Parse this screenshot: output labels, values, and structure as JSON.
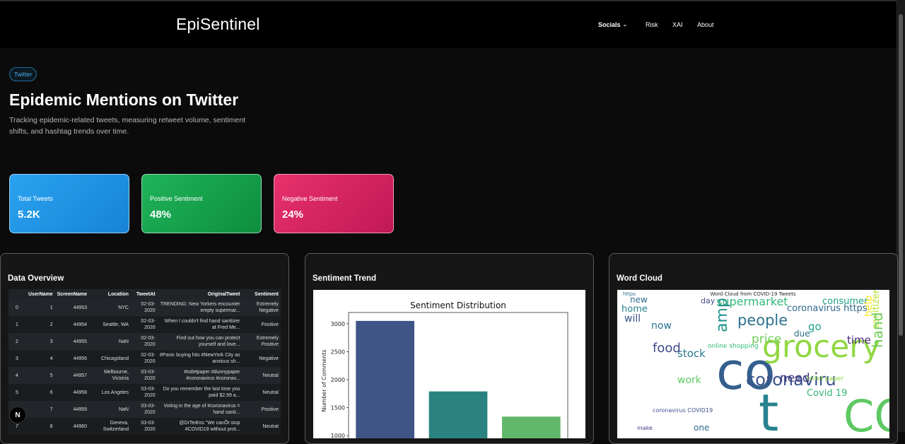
{
  "nav": {
    "brand": "EpiSentinel",
    "items": [
      {
        "label": "Socials",
        "has_dropdown": true
      },
      {
        "label": "Risk"
      },
      {
        "label": "XAI"
      },
      {
        "label": "About"
      }
    ]
  },
  "hero": {
    "badge": "Twitter",
    "title": "Epidemic Mentions on Twitter",
    "subtitle": "Tracking epidemic-related tweets, measuring retweet volume, sentiment shifts, and hashtag trends over time."
  },
  "stats": [
    {
      "label": "Total Tweets",
      "value": "5.2K"
    },
    {
      "label": "Positive Sentiment",
      "value": "48%"
    },
    {
      "label": "Negative Sentiment",
      "value": "24%"
    }
  ],
  "data_overview": {
    "title": "Data Overview",
    "columns": [
      "",
      "UserName",
      "ScreenName",
      "Location",
      "TweetAt",
      "OriginalTweet",
      "Sentiment"
    ],
    "rows": [
      [
        "0",
        "1",
        "44953",
        "NYC",
        "02-03-2020",
        "TRENDING: New Yorkers encounter empty supermar...",
        "Extremely Negative"
      ],
      [
        "1",
        "2",
        "44954",
        "Seattle, WA",
        "02-03-2020",
        "When I couldn't find hand sanitizer at Fred Me...",
        "Positive"
      ],
      [
        "2",
        "3",
        "44955",
        "NaN",
        "02-03-2020",
        "Find out how you can protect yourself and love...",
        "Extremely Positive"
      ],
      [
        "3",
        "4",
        "44956",
        "Chicagoland",
        "02-03-2020",
        "#Panic buying hits #NewYork City as anxious sh...",
        "Negative"
      ],
      [
        "4",
        "5",
        "44957",
        "Melbourne, Victoria",
        "03-03-2020",
        "#toiletpaper #dunnypaper #coronavirus #coronav...",
        "Neutral"
      ],
      [
        "5",
        "6",
        "44958",
        "Los Angeles",
        "03-03-2020",
        "Do you remember the last time you paid $2.99 a...",
        "Neutral"
      ],
      [
        "6",
        "7",
        "44959",
        "NaN",
        "03-03-2020",
        "Voting in the age of #coronavirus = hand sanit...",
        "Positive"
      ],
      [
        "7",
        "8",
        "44960",
        "Geneva, Switzerland",
        "03-03-2020",
        "@DrTedros \"We canÕt stop #COVID19 without prot...",
        "Neutral"
      ]
    ]
  },
  "sentiment_trend": {
    "title": "Sentiment Trend"
  },
  "chart_data": {
    "type": "bar",
    "title": "Sentiment Distribution",
    "ylabel": "Number of Comments",
    "xlabel": "",
    "categories": [
      "",
      "",
      ""
    ],
    "values": [
      3050,
      1790,
      1340
    ],
    "ylim": [
      0,
      3200
    ],
    "yticks": [
      1000,
      1500,
      2000,
      2500,
      3000
    ],
    "colors": [
      "#3f5588",
      "#2a8380",
      "#62b86a"
    ],
    "grid": false
  },
  "word_cloud": {
    "title": "Word Cloud",
    "image_title": "Word Cloud from COVID-19 Tweets",
    "words": [
      {
        "text": "https",
        "color": "#2d6f8e"
      },
      {
        "text": "co",
        "color": "#355f8d"
      },
      {
        "text": "t",
        "color": "#26828e"
      },
      {
        "text": "COVID",
        "color": "#5ec962"
      },
      {
        "text": "grocery store",
        "color": "#90d743"
      },
      {
        "text": "coronaviru",
        "color": "#3b528b"
      },
      {
        "text": "people",
        "color": "#2c728e"
      },
      {
        "text": "supermarket",
        "color": "#35b779"
      },
      {
        "text": "coronavirus https",
        "color": "#31688e"
      },
      {
        "text": "food",
        "color": "#3e4989"
      },
      {
        "text": "price",
        "color": "#6ece58"
      },
      {
        "text": "amp",
        "color": "#21918c"
      },
      {
        "text": "consumer",
        "color": "#1f9e89"
      },
      {
        "text": "need",
        "color": "#443983"
      },
      {
        "text": "Covid 19",
        "color": "#35b779"
      },
      {
        "text": "stock",
        "color": "#2a788e"
      },
      {
        "text": "home",
        "color": "#26828e"
      },
      {
        "text": "now",
        "color": "#2c728e"
      },
      {
        "text": "time",
        "color": "#482878"
      },
      {
        "text": "go",
        "color": "#1fa188"
      },
      {
        "text": "work",
        "color": "#5ec962"
      },
      {
        "text": "will",
        "color": "#3b528b"
      },
      {
        "text": "new",
        "color": "#31688e"
      },
      {
        "text": "sanitizer",
        "color": "#b5de2b"
      },
      {
        "text": "hand",
        "color": "#6ece58"
      },
      {
        "text": "help",
        "color": "#fde725"
      },
      {
        "text": "online shopping",
        "color": "#35b779"
      },
      {
        "text": "day",
        "color": "#3e4989"
      },
      {
        "text": "due",
        "color": "#2d6f8e"
      },
      {
        "text": "toilet paper",
        "color": "#90d743"
      },
      {
        "text": "one",
        "color": "#31688e"
      },
      {
        "text": "make",
        "color": "#443983"
      },
      {
        "text": "coronavirus COVID19",
        "color": "#3b528b"
      }
    ]
  }
}
